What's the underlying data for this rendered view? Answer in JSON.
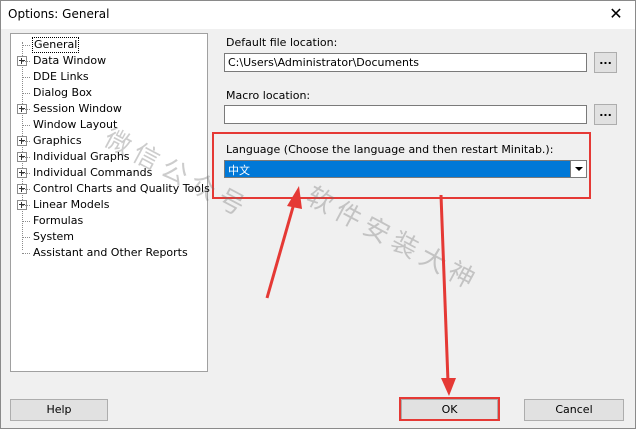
{
  "window": {
    "title": "Options: General",
    "close_icon": "close-icon"
  },
  "tree": {
    "items": [
      {
        "label": "General",
        "expandable": false,
        "selected": true
      },
      {
        "label": "Data Window",
        "expandable": true
      },
      {
        "label": "DDE Links",
        "expandable": false
      },
      {
        "label": "Dialog Box",
        "expandable": false
      },
      {
        "label": "Session Window",
        "expandable": true
      },
      {
        "label": "Window Layout",
        "expandable": false
      },
      {
        "label": "Graphics",
        "expandable": true
      },
      {
        "label": "Individual Graphs",
        "expandable": true
      },
      {
        "label": "Individual Commands",
        "expandable": true
      },
      {
        "label": "Control Charts and Quality Tools",
        "expandable": true
      },
      {
        "label": "Linear Models",
        "expandable": true
      },
      {
        "label": "Formulas",
        "expandable": false
      },
      {
        "label": "System",
        "expandable": false
      },
      {
        "label": "Assistant and Other Reports",
        "expandable": false
      }
    ]
  },
  "fields": {
    "default_location_label": "Default file location:",
    "default_location_value": "C:\\Users\\Administrator\\Documents",
    "macro_location_label": "Macro location:",
    "macro_location_value": "",
    "language_label": "Language (Choose the language and then restart Minitab.):",
    "language_value": "中文",
    "browse_label": "..."
  },
  "buttons": {
    "help": "Help",
    "ok": "OK",
    "cancel": "Cancel"
  },
  "watermark": {
    "line1": "微信公众号",
    "line2": "软件安装大神"
  },
  "colors": {
    "highlight": "#e53935",
    "selection": "#0078d7"
  }
}
